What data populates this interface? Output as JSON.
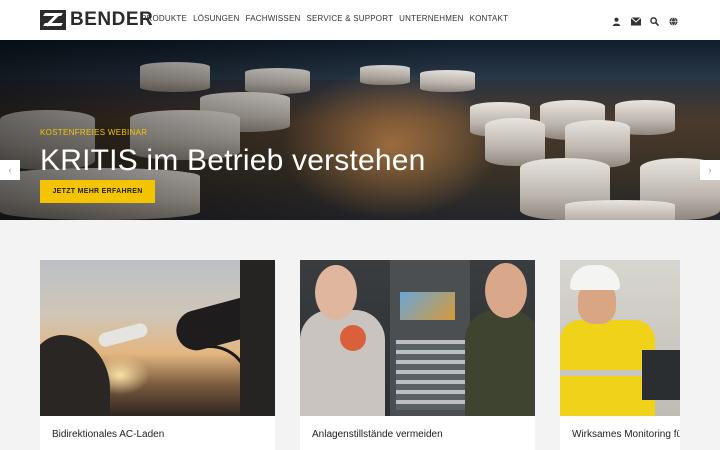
{
  "brand": {
    "name": "BENDER"
  },
  "nav": {
    "items": [
      "PRODUKTE",
      "LÖSUNGEN",
      "FACHWISSEN",
      "SERVICE & SUPPORT",
      "UNTERNEHMEN",
      "KONTAKT"
    ]
  },
  "header_icons": [
    "user-icon",
    "mail-icon",
    "search-icon",
    "globe-icon"
  ],
  "hero": {
    "kicker": "KOSTENFREIES WEBINAR",
    "title": "KRITIS im Betrieb verstehen",
    "button": "JETZT MEHR ERFAHREN",
    "prev": "‹",
    "next": "›"
  },
  "cards": [
    {
      "title": "Bidirektionales AC-Laden"
    },
    {
      "title": "Anlagenstillstände vermeiden"
    },
    {
      "title": "Wirksames Monitoring für"
    }
  ],
  "colors": {
    "accent": "#f5c400",
    "text_dark": "#2b2b2b",
    "background": "#f3f3f3"
  }
}
